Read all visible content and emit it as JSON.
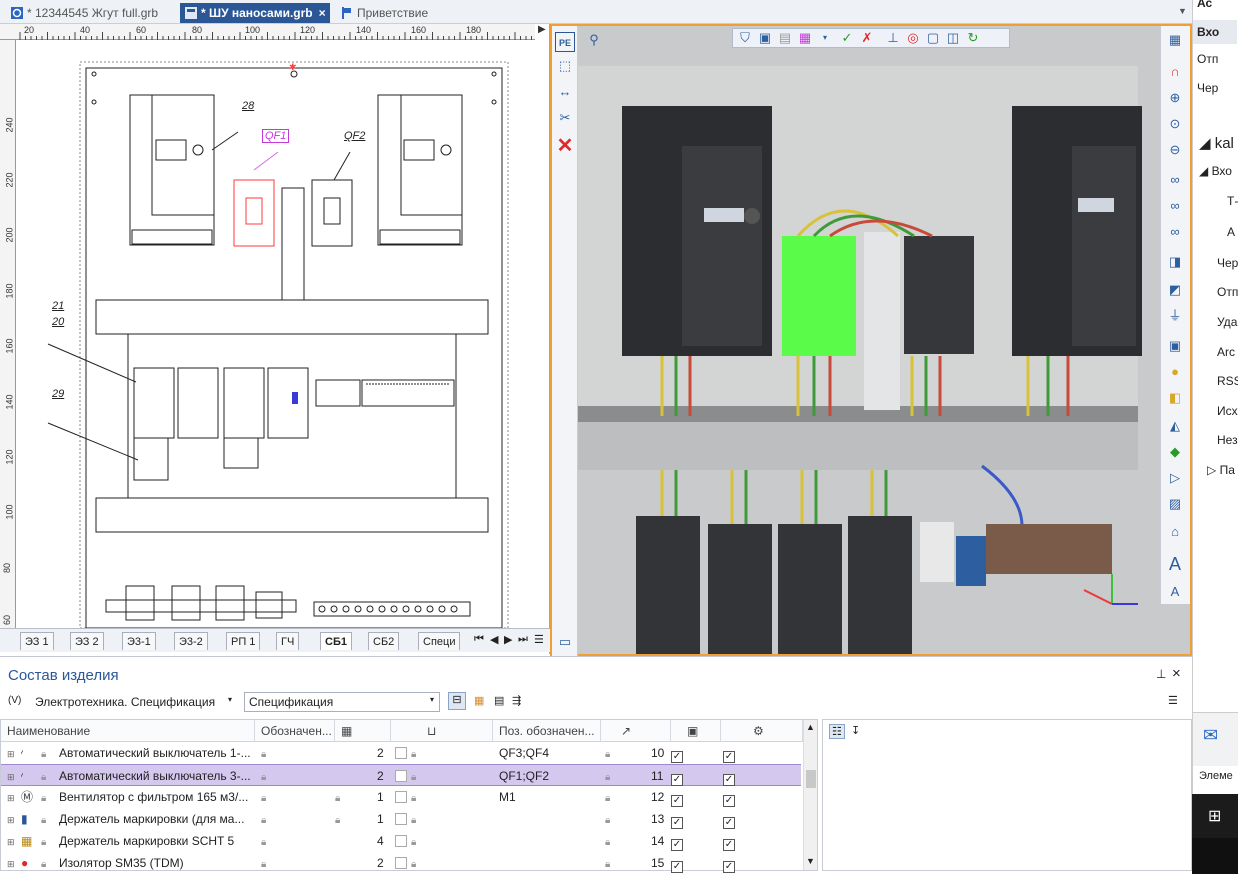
{
  "doc_tabs": [
    {
      "label": "* 12344545 Жгут full.grb",
      "active": false
    },
    {
      "label": "* ШУ наносами.grb",
      "active": true
    },
    {
      "label": "Приветствие",
      "active": false
    }
  ],
  "ruler": {
    "h_ticks": [
      "20",
      "40",
      "60",
      "80",
      "100",
      "120",
      "140",
      "160",
      "180"
    ],
    "v_ticks": [
      "240",
      "220",
      "200",
      "180",
      "160",
      "140",
      "120",
      "100",
      "80",
      "60"
    ]
  },
  "drawing_labels": {
    "l28": "28",
    "qf1": "QF1",
    "qf2": "QF2",
    "l21": "21",
    "l20": "20",
    "l29": "29"
  },
  "sheet_tabs": [
    {
      "label": "ЭЗ 1",
      "active": false
    },
    {
      "label": "ЭЗ 2",
      "active": false
    },
    {
      "label": "Э3-1",
      "active": false
    },
    {
      "label": "Э3-2",
      "active": false
    },
    {
      "label": "РП 1",
      "active": false
    },
    {
      "label": "ГЧ",
      "active": false
    },
    {
      "label": "СБ1",
      "active": true
    },
    {
      "label": "СБ2",
      "active": false
    },
    {
      "label": "Специ",
      "active": false
    }
  ],
  "side_panel": {
    "items": [
      "Ас",
      "Вхо",
      "Отп",
      "Чер",
      "kal",
      "Вхо",
      "Т-",
      "А",
      "Чер",
      "Отп",
      "Уда",
      "Arc",
      "RSS",
      "Исх",
      "Нез",
      "Па"
    ],
    "status_text": "Элеме"
  },
  "bottom": {
    "title": "Состав изделия",
    "pin_icon": "pin-icon",
    "close_label": "×",
    "variant_label": "(V)",
    "combo1": "Электротехника. Спецификация",
    "combo2": "Спецификация",
    "columns": [
      "Наименование",
      "Обозначен...",
      "",
      "",
      "Поз. обозначен...",
      "",
      "",
      ""
    ],
    "rows": [
      {
        "name": "Автоматический выключатель 1-...",
        "qty": "2",
        "pos": "QF3;QF4",
        "num": "10",
        "c1": true,
        "c2": true,
        "selected": false
      },
      {
        "name": "Автоматический выключатель 3-...",
        "qty": "2",
        "pos": "QF1;QF2",
        "num": "11",
        "c1": true,
        "c2": true,
        "selected": true
      },
      {
        "name": "Вентилятор с фильтром 165 м3/...",
        "qty": "1",
        "pos": "M1",
        "num": "12",
        "c1": true,
        "c2": true,
        "selected": false
      },
      {
        "name": "Держатель маркировки (для ма...",
        "qty": "1",
        "pos": "",
        "num": "13",
        "c1": true,
        "c2": true,
        "selected": false
      },
      {
        "name": "Держатель маркировки SCHT 5",
        "qty": "4",
        "pos": "",
        "num": "14",
        "c1": true,
        "c2": true,
        "selected": false
      },
      {
        "name": "Изолятор SM35 (TDM)",
        "qty": "2",
        "pos": "",
        "num": "15",
        "c1": true,
        "c2": true,
        "selected": false
      }
    ]
  },
  "colors": {
    "accent": "#2b5797",
    "viewport_border": "#f0a030",
    "selection": "#d5c8ef",
    "highlight_green": "#4cff3a",
    "drawing_red": "#ff3b3b"
  }
}
